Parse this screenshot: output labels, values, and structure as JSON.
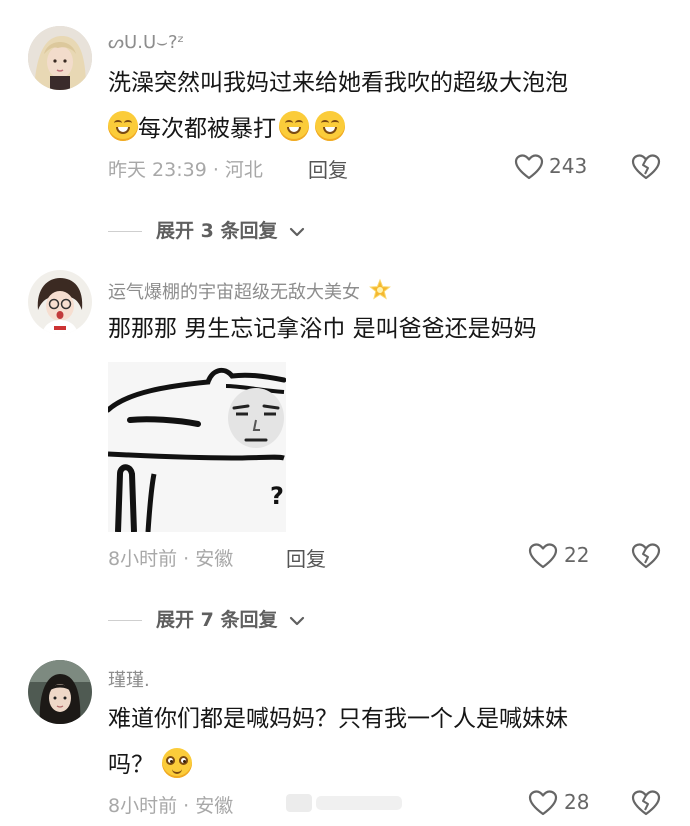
{
  "comments": [
    {
      "username": "ᔕᑌ.ᑌ⌣?ᶻ",
      "text_line1": "洗澡突然叫我妈过来给她看我吹的超级大泡泡",
      "text_line2": "每次都被暴打",
      "meta": "昨天 23:39 · 河北",
      "reply_label": "回复",
      "like_count": "243",
      "expand_label": "展开 3 条回复"
    },
    {
      "username": "运气爆棚的宇宙超级无敌大美女",
      "text_line1": "那那那 男生忘记拿浴巾 是叫爸爸还是妈妈",
      "sticker_mark": "?",
      "meta": "8小时前 · 安徽",
      "reply_label": "回复",
      "like_count": "22",
      "expand_label": "展开 7 条回复"
    },
    {
      "username": "瑾瑾.",
      "text_line1": "难道你们都是喊妈妈？只有我一个人是喊妹妹",
      "text_line2": "吗？",
      "meta": "8小时前 · 安徽",
      "like_count": "28"
    }
  ],
  "colors": {
    "text": "#161616",
    "muted": "#a8a8a8",
    "emoji": "#fbcc3a",
    "badge": "#f5b82e"
  },
  "icons": [
    "heart-outline-icon",
    "broken-heart-icon",
    "chevron-down-icon",
    "star-badge-icon",
    "grin-emoji-icon",
    "wide-eyes-emoji-icon"
  ]
}
